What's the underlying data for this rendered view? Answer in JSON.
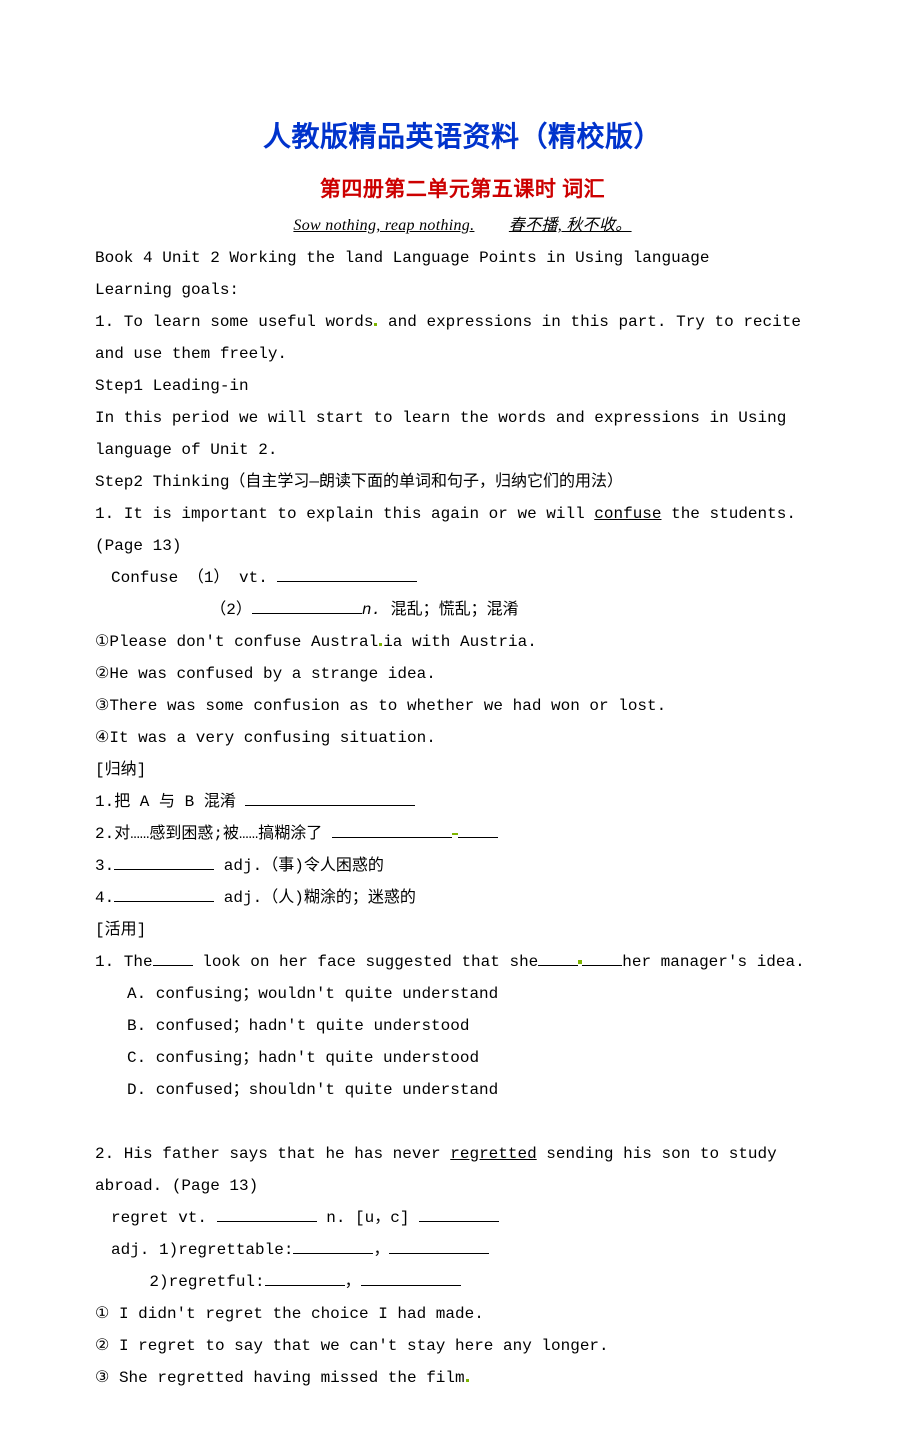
{
  "title": {
    "main": "人教版精品英语资料（精校版）",
    "sub": "第四册第二单元第五课时   词汇"
  },
  "motto": {
    "en": "Sow nothing, reap nothing.",
    "zh": "春不播, 秋不收。"
  },
  "header": {
    "book_line": "Book 4  Unit 2  Working the land   Language Points in Using language",
    "goals_label": "Learning goals:",
    "goal1": "1. To learn some useful words",
    "goal1b": " and expressions in this part. Try to recite and use them freely."
  },
  "steps": {
    "step1_label": "Step1 Leading-in",
    "step1_text": "In this period we will start to learn the words and expressions in Using language of Unit 2.",
    "step2_label": "Step2 Thinking（自主学习—朗读下面的单词和句子，归纳它们的用法）"
  },
  "q1": {
    "line1a": "1. It is important to explain this again or we will ",
    "confuse": "confuse",
    "line1b": " the students. (Page 13)",
    "confuse_line": "Confuse  （1） vt. ",
    "n_line_pre": "            （2）",
    "n_label": "n.",
    "n_meaning": " 混乱；慌乱；混淆",
    "ex1": "①Please don't confuse Austral",
    "ex1_dot": "",
    "ex1b": "ia with Austria.",
    "ex2": "②He was confused by a strange idea.",
    "ex3": "③There was some confusion as to whether we had won or lost.",
    "ex4": "④It was a very confusing situation.",
    "guina_label": "[归纳]",
    "g1": "1.把 A 与 B 混淆   ",
    "g2": "2.对……感到困惑;被……搞糊涂了 ",
    "g3": "3.",
    "g3b": " adj.（事)令人困惑的",
    "g4": "4.",
    "g4b": " adj.（人)糊涂的；迷惑的",
    "huo_label": "[活用]",
    "h1a": "1. The",
    "h1b": " look on her face suggested that she",
    "h1c": "her manager's idea.",
    "optA": "A. confusing；wouldn't quite understand",
    "optB": "B. confused；hadn't quite understood",
    "optC": "C. confusing；hadn't quite understood",
    "optD": "D. confused；shouldn't quite understand"
  },
  "q2": {
    "line1a": "2. His father says that he has never ",
    "regretted": "regretted",
    "line1b": " sending his son to study abroad. (Page 13)",
    "regret_vt": "regret  vt. ",
    "regret_n": " n. [u，c] ",
    "adj_line1": "adj. 1)regrettable:",
    "adj_comma": "，",
    "adj_line2": "    2)regretful:",
    "ex1": "① I didn't regret the choice I had made.",
    "ex2": "② I regret to say that we can't stay here any longer.",
    "ex3": "③ She regretted having missed the film",
    "ex3_dot": "."
  }
}
